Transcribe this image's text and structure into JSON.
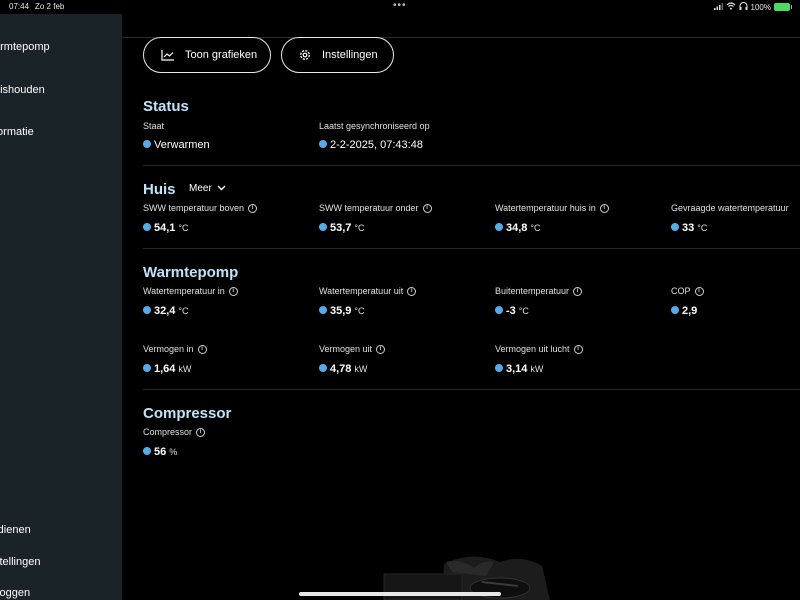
{
  "statusbar": {
    "time": "07:44",
    "date": "Zo 2 feb",
    "dots": "•••",
    "battery": "100%"
  },
  "sidebar": {
    "items": [
      {
        "label": "armtepomp"
      },
      {
        "label": "uishouden"
      },
      {
        "label": "formatie"
      },
      {
        "label": "rdienen"
      },
      {
        "label": "stellingen"
      },
      {
        "label": "tloggen"
      }
    ]
  },
  "toolbar": {
    "charts_label": "Toon grafieken",
    "settings_label": "Instellingen"
  },
  "status": {
    "title": "Status",
    "state_label": "Staat",
    "state_value": "Verwarmen",
    "sync_label": "Laatst gesynchroniseerd op",
    "sync_value": "2-2-2025, 07:43:48"
  },
  "huis": {
    "title": "Huis",
    "more_label": "Meer",
    "metrics": [
      {
        "label": "SWW temperatuur boven",
        "value": "54,1",
        "unit": "°C"
      },
      {
        "label": "SWW temperatuur onder",
        "value": "53,7",
        "unit": "°C"
      },
      {
        "label": "Watertemperatuur huis in",
        "value": "34,8",
        "unit": "°C"
      },
      {
        "label": "Gevraagde watertemperatuur",
        "value": "33",
        "unit": "°C"
      }
    ]
  },
  "warmtepomp": {
    "title": "Warmtepomp",
    "metrics": [
      {
        "label": "Watertemperatuur in",
        "value": "32,4",
        "unit": "°C"
      },
      {
        "label": "Watertemperatuur uit",
        "value": "35,9",
        "unit": "°C"
      },
      {
        "label": "Buitentemperatuur",
        "value": "-3",
        "unit": "°C"
      },
      {
        "label": "COP",
        "value": "2,9",
        "unit": ""
      },
      {
        "label": "Vermogen in",
        "value": "1,64",
        "unit": "kW"
      },
      {
        "label": "Vermogen uit",
        "value": "4,78",
        "unit": "kW"
      },
      {
        "label": "Vermogen uit lucht",
        "value": "3,14",
        "unit": "kW"
      }
    ]
  },
  "compressor": {
    "title": "Compressor",
    "metrics": [
      {
        "label": "Compressor",
        "value": "56",
        "unit": "%"
      }
    ]
  },
  "colors": {
    "accent_dot": "#5aa9e6",
    "section_title": "#bfe3f8",
    "sidebar_bg": "#1a2327"
  }
}
